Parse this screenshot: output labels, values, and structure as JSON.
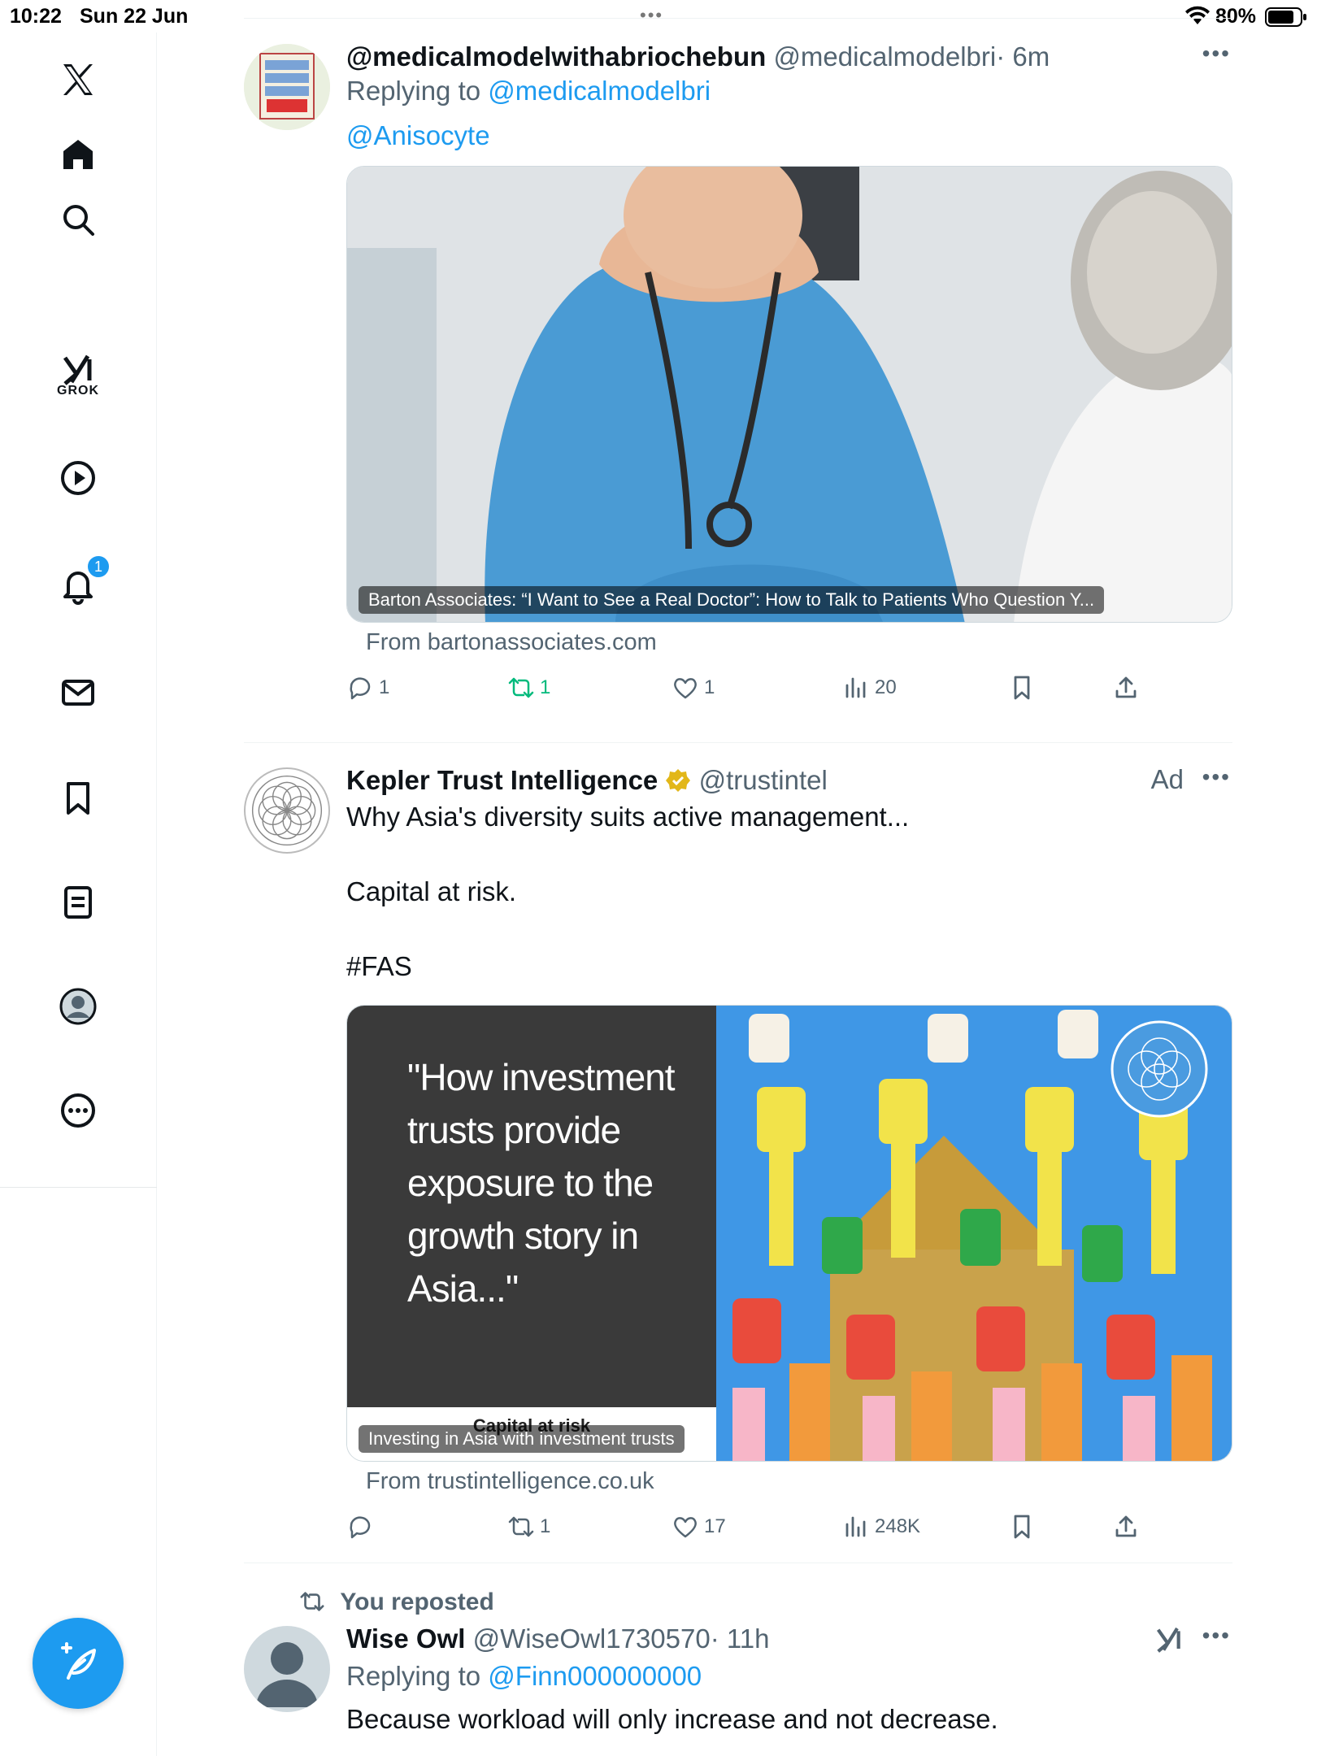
{
  "status_bar": {
    "time": "10:22",
    "date": "Sun 22 Jun",
    "battery": "80%"
  },
  "sidebar": {
    "grok_label": "GROK",
    "notification_count": "1"
  },
  "tweets": [
    {
      "name": "@medicalmodelwithabriochebun",
      "handle": "@medicalmodelbri",
      "time": "· 6m",
      "replying_prefix": "Replying to",
      "replying_to": "@medicalmodelbri",
      "mention": "@Anisocyte",
      "card_caption": "Barton Associates: “I Want to See a Real Doctor”: How to Talk to Patients Who Question Y...",
      "card_from": "From bartonassociates.com",
      "replies": "1",
      "reposts": "1",
      "likes": "1",
      "views": "20"
    },
    {
      "name": "Kepler Trust Intelligence",
      "handle": "@trustintel",
      "ad_label": "Ad",
      "text_line1": "Why Asia's diversity suits active management...",
      "text_line2": "Capital at risk.",
      "hashtag": "#FAS",
      "card_quote": "\"How investment trusts provide exposure to the growth story in Asia...\"",
      "card_footer": "Capital at risk",
      "card_caption": "Investing in Asia with investment trusts",
      "card_from": "From trustintelligence.co.uk",
      "replies": "",
      "reposts": "1",
      "likes": "17",
      "views": "248K"
    },
    {
      "repost_label": "You reposted",
      "name": "Wise Owl",
      "handle": "@WiseOwl1730570",
      "time": "· 11h",
      "replying_prefix": "Replying to",
      "replying_to": "@Finn000000000",
      "text": "Because workload will only increase and not decrease."
    }
  ],
  "colors": {
    "accent": "#1d9bf0",
    "repost_green": "#00ba7c",
    "muted": "#536471"
  }
}
